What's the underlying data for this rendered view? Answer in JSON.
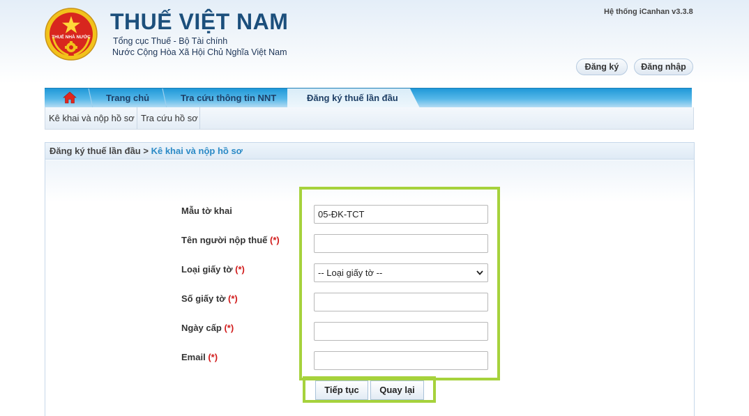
{
  "header": {
    "emblem_text": "THUẾ NHÀ NƯỚC",
    "title": "THUẾ VIỆT NAM",
    "subtitle1": "Tổng cục Thuế - Bộ Tài chính",
    "subtitle2": "Nước Cộng Hòa Xã Hội Chủ Nghĩa Việt Nam",
    "system_version": "Hệ thống iCanhan v3.3.8",
    "register_label": "Đăng ký",
    "login_label": "Đăng nhập"
  },
  "nav": {
    "home_icon": "home-icon",
    "items": [
      {
        "label": "Trang chủ"
      },
      {
        "label": "Tra cứu thông tin NNT"
      },
      {
        "label": "Đăng ký thuế lần đầu",
        "active": true
      }
    ]
  },
  "subnav": {
    "items": [
      {
        "label": "Kê khai và nộp hồ sơ"
      },
      {
        "label": "Tra cứu hồ sơ"
      }
    ]
  },
  "breadcrumb": {
    "parent": "Đăng ký thuế lần đầu",
    "separator": ">",
    "current": "Kê khai và nộp hồ sơ"
  },
  "form": {
    "required_mark": "(*)",
    "fields": [
      {
        "label": "Mẫu tờ khai",
        "value": "05-ĐK-TCT",
        "required": false
      },
      {
        "label": "Tên người nộp thuế",
        "value": "",
        "required": true
      },
      {
        "label": "Loại giấy tờ",
        "value": "-- Loại giấy tờ --",
        "required": true
      },
      {
        "label": "Số giấy tờ",
        "value": "",
        "required": true
      },
      {
        "label": "Ngày cấp",
        "value": "",
        "required": true
      },
      {
        "label": "Email",
        "value": "",
        "required": true
      }
    ],
    "continue_label": "Tiếp tục",
    "back_label": "Quay lại"
  },
  "colors": {
    "brand_blue": "#1c4f7c",
    "nav_blue": "#1f98d8",
    "highlight_green": "#a6d23c",
    "required_red": "#d11a1a",
    "link_blue": "#2b8ac6"
  }
}
